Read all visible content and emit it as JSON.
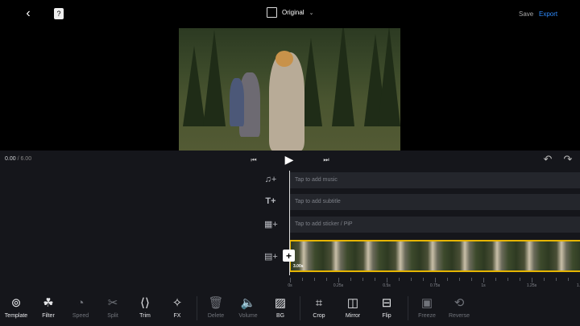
{
  "header": {
    "aspect_label": "Original",
    "save_label": "Save",
    "export_label": "Export",
    "accent": "#2f8cff"
  },
  "playback": {
    "current_time": "0.00",
    "total_time": "6.00",
    "separator": " / "
  },
  "tracks": {
    "music": "Tap to add music",
    "subtitle": "Tap to add subtitle",
    "sticker": "Tap to add sticker / PiP",
    "clip_duration": "3.00s"
  },
  "ruler": [
    "0s",
    "0.25s",
    "0.5s",
    "0.75s",
    "1s",
    "1.25s",
    "1."
  ],
  "toolbar": [
    {
      "label": "Template",
      "icon": "template-icon",
      "glyph": "⊚",
      "enabled": true
    },
    {
      "label": "Filter",
      "icon": "filter-icon",
      "glyph": "☘",
      "enabled": true
    },
    {
      "label": "Speed",
      "icon": "speed-icon",
      "glyph": "◔",
      "enabled": false
    },
    {
      "label": "Split",
      "icon": "scissors-icon",
      "glyph": "✂",
      "enabled": false
    },
    {
      "label": "Trim",
      "icon": "trim-icon",
      "glyph": "⟨⟩",
      "enabled": true
    },
    {
      "label": "FX",
      "icon": "fx-icon",
      "glyph": "✧",
      "enabled": true
    },
    {
      "label": "Delete",
      "icon": "trash-icon",
      "glyph": "🗑",
      "enabled": false
    },
    {
      "label": "Volume",
      "icon": "volume-icon",
      "glyph": "🔈",
      "enabled": false
    },
    {
      "label": "BG",
      "icon": "background-icon",
      "glyph": "▨",
      "enabled": true
    },
    {
      "label": "Crop",
      "icon": "crop-icon",
      "glyph": "⌗",
      "enabled": true
    },
    {
      "label": "Mirror",
      "icon": "mirror-icon",
      "glyph": "◫",
      "enabled": true
    },
    {
      "label": "Flip",
      "icon": "flip-icon",
      "glyph": "⊟",
      "enabled": true
    },
    {
      "label": "Freeze",
      "icon": "freeze-icon",
      "glyph": "▣",
      "enabled": false
    },
    {
      "label": "Reverse",
      "icon": "reverse-icon",
      "glyph": "⟲",
      "enabled": false
    }
  ]
}
